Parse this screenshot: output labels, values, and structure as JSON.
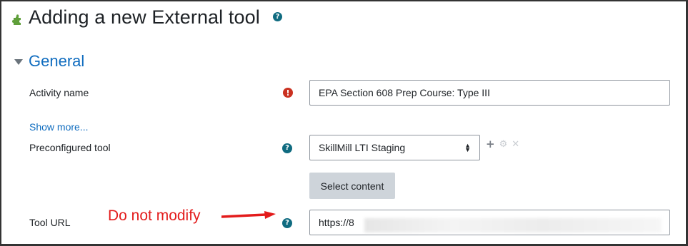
{
  "page": {
    "title": "Adding a new External tool",
    "title_help_icon": "question-circle-icon",
    "module_icon": "puzzle-piece-icon"
  },
  "section": {
    "title": "General",
    "collapsed": false
  },
  "form": {
    "activity_name": {
      "label": "Activity name",
      "value": "EPA Section 608 Prep Course: Type III",
      "required": true,
      "required_icon": "exclamation-circle-icon"
    },
    "show_more": "Show more...",
    "preconfigured_tool": {
      "label": "Preconfigured tool",
      "selected": "SkillMill LTI Staging",
      "help_icon": "question-circle-icon",
      "actions": [
        "add-icon",
        "gear-icon",
        "delete-icon"
      ]
    },
    "select_content_label": "Select content",
    "tool_url": {
      "label": "Tool URL",
      "value": "https://8",
      "help_icon": "question-circle-icon"
    }
  },
  "annotation": {
    "text": "Do not modify",
    "color": "#e31b1b"
  },
  "colors": {
    "link": "#0f6cbf",
    "help": "#0f6b80",
    "required": "#ca3120",
    "button": "#ced4da"
  }
}
